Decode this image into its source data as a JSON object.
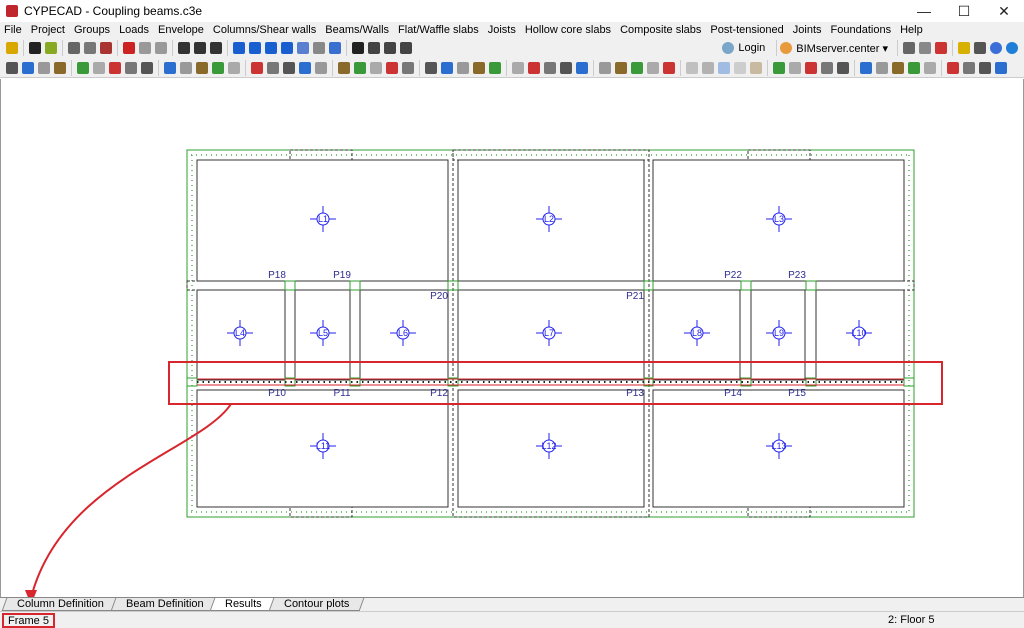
{
  "window": {
    "title": "CYPECAD - Coupling beams.c3e",
    "minimize": "—",
    "maximize": "☐",
    "close": "✕"
  },
  "menu": [
    "File",
    "Project",
    "Groups",
    "Loads",
    "Envelope",
    "Columns/Shear walls",
    "Beams/Walls",
    "Flat/Waffle slabs",
    "Joists",
    "Hollow core slabs",
    "Composite slabs",
    "Post-tensioned",
    "Joints",
    "Foundations",
    "Help"
  ],
  "toolbar": {
    "login": "Login",
    "bimserver": "BIMserver.center ▾"
  },
  "drawing": {
    "slabs": [
      "L1",
      "L2",
      "L3",
      "L4",
      "L5",
      "L6",
      "L7",
      "L8",
      "L9",
      "L10",
      "L11",
      "L12",
      "L13"
    ],
    "columns": [
      "P18",
      "P19",
      "P20",
      "P21",
      "P22",
      "P23",
      "P10",
      "P11",
      "P12",
      "P13",
      "P14",
      "P15"
    ],
    "colors": {
      "slab": "#2222ee",
      "beam": "#d7262e",
      "column": "#2ca02c",
      "highlight": "#d7262e"
    }
  },
  "tabs": [
    "Column Definition",
    "Beam Definition",
    "Results",
    "Contour plots"
  ],
  "active_tab": "Results",
  "status": {
    "frame": "Frame 5",
    "floor": "2: Floor 5"
  }
}
